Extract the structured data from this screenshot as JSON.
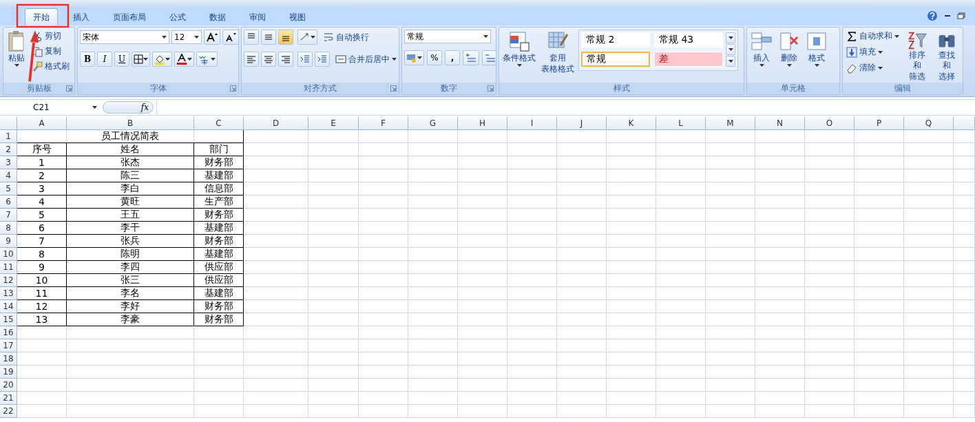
{
  "tabs": [
    {
      "label": "开始",
      "selected": true
    },
    {
      "label": "插入",
      "selected": false
    },
    {
      "label": "页面布局",
      "selected": false
    },
    {
      "label": "公式",
      "selected": false
    },
    {
      "label": "数据",
      "selected": false
    },
    {
      "label": "审阅",
      "selected": false
    },
    {
      "label": "视图",
      "selected": false
    }
  ],
  "ribbon": {
    "clipboard": {
      "label": "剪贴板",
      "paste": "粘贴",
      "actions": [
        {
          "kind": "cut",
          "label": "剪切"
        },
        {
          "kind": "copy",
          "label": "复制"
        },
        {
          "kind": "painter",
          "label": "格式刷"
        }
      ]
    },
    "font": {
      "label": "字体",
      "font_name": "宋体",
      "font_size": "12",
      "styles": [
        "B",
        "I",
        "U"
      ]
    },
    "alignment": {
      "label": "对齐方式",
      "vertical": [
        {
          "selected": false
        },
        {
          "selected": false
        },
        {
          "selected": true
        }
      ],
      "wrap_text": "自动换行",
      "merge_center": "合并后居中"
    },
    "number": {
      "label": "数字",
      "format": "常规",
      "percent": "%",
      "comma": ","
    },
    "styles": {
      "label": "样式",
      "conditional_format": "条件格式",
      "table_format": [
        "套用",
        "表格格式"
      ],
      "gallery": [
        {
          "label": "常规 2",
          "kind": "normal",
          "selected": false
        },
        {
          "label": "常规 43",
          "kind": "normal",
          "selected": false
        },
        {
          "label": "常规",
          "kind": "normal",
          "selected": true
        },
        {
          "label": "差",
          "kind": "bad",
          "selected": false
        }
      ]
    },
    "cells": {
      "label": "单元格",
      "buttons": [
        {
          "kind": "insert",
          "label": "插入"
        },
        {
          "kind": "delete",
          "label": "删除"
        },
        {
          "kind": "format",
          "label": "格式"
        }
      ]
    },
    "editing": {
      "label": "编辑",
      "small": [
        {
          "kind": "sum",
          "label": "自动求和"
        },
        {
          "kind": "fill",
          "label": "填充"
        },
        {
          "kind": "clear",
          "label": "清除"
        }
      ],
      "large": [
        {
          "kind": "sort",
          "lines": [
            "排序和",
            "筛选"
          ]
        },
        {
          "kind": "find",
          "lines": [
            "查找和",
            "选择"
          ]
        }
      ]
    }
  },
  "formula_bar": {
    "name_box": "C21",
    "fx": "fx"
  },
  "sheet": {
    "columns": [
      "A",
      "B",
      "C",
      "D",
      "E",
      "F",
      "G",
      "H",
      "I",
      "J",
      "K",
      "L",
      "M",
      "N",
      "O",
      "P",
      "Q"
    ],
    "row_numbers": [
      "1",
      "2",
      "3",
      "4",
      "5",
      "6",
      "7",
      "8",
      "9",
      "10",
      "11",
      "12",
      "13",
      "14",
      "15",
      "16",
      "17",
      "18",
      "19",
      "20",
      "21",
      "22"
    ],
    "title": "员工情况简表",
    "header": [
      "序号",
      "姓名",
      "部门"
    ],
    "rows": [
      [
        "1",
        "张杰",
        "财务部"
      ],
      [
        "2",
        "陈三",
        "基建部"
      ],
      [
        "3",
        "李白",
        "信息部"
      ],
      [
        "4",
        "黄旺",
        "生产部"
      ],
      [
        "5",
        "王五",
        "财务部"
      ],
      [
        "6",
        "李干",
        "基建部"
      ],
      [
        "7",
        "张兵",
        "财务部"
      ],
      [
        "8",
        "陈明",
        "基建部"
      ],
      [
        "9",
        "李四",
        "供应部"
      ],
      [
        "10",
        "张三",
        "供应部"
      ],
      [
        "11",
        "李名",
        "基建部"
      ],
      [
        "12",
        "李好",
        "财务部"
      ],
      [
        "13",
        "李豪",
        "财务部"
      ]
    ]
  }
}
